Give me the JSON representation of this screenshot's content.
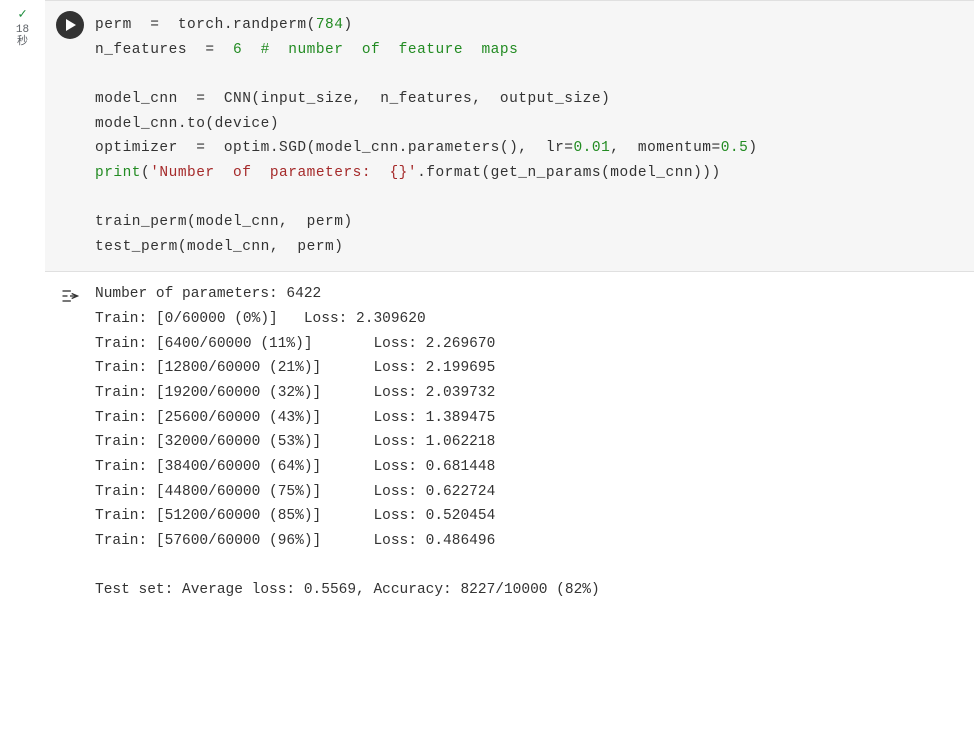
{
  "status": {
    "check": "✓",
    "time_num": "18",
    "time_unit": "秒"
  },
  "code": {
    "l1_a": "perm  =  torch.randperm(",
    "l1_num": "784",
    "l1_b": ")",
    "l2_a": "n_features  =  ",
    "l2_num": "6",
    "l2_b": "  ",
    "l2_cm": "#  number  of  feature  maps",
    "l4": "model_cnn  =  CNN(input_size,  n_features,  output_size)",
    "l5": "model_cnn.to(device)",
    "l6_a": "optimizer  =  optim.SGD(model_cnn.parameters(),  lr=",
    "l6_n1": "0.01",
    "l6_b": ",  momentum=",
    "l6_n2": "0.5",
    "l6_c": ")",
    "l7_print": "print",
    "l7_a": "(",
    "l7_str": "'Number  of  parameters:  {}'",
    "l7_b": ".format(get_n_params(model_cnn)))",
    "l9": "train_perm(model_cnn,  perm)",
    "l10": "test_perm(model_cnn,  perm)"
  },
  "output": {
    "header": "Number of parameters: 6422",
    "lines": [
      "Train: [0/60000 (0%)]   Loss: 2.309620",
      "Train: [6400/60000 (11%)]       Loss: 2.269670",
      "Train: [12800/60000 (21%)]      Loss: 2.199695",
      "Train: [19200/60000 (32%)]      Loss: 2.039732",
      "Train: [25600/60000 (43%)]      Loss: 1.389475",
      "Train: [32000/60000 (53%)]      Loss: 1.062218",
      "Train: [38400/60000 (64%)]      Loss: 0.681448",
      "Train: [44800/60000 (75%)]      Loss: 0.622724",
      "Train: [51200/60000 (85%)]      Loss: 0.520454",
      "Train: [57600/60000 (96%)]      Loss: 0.486496"
    ],
    "blank": "",
    "test": "Test set: Average loss: 0.5569, Accuracy: 8227/10000 (82%)"
  }
}
